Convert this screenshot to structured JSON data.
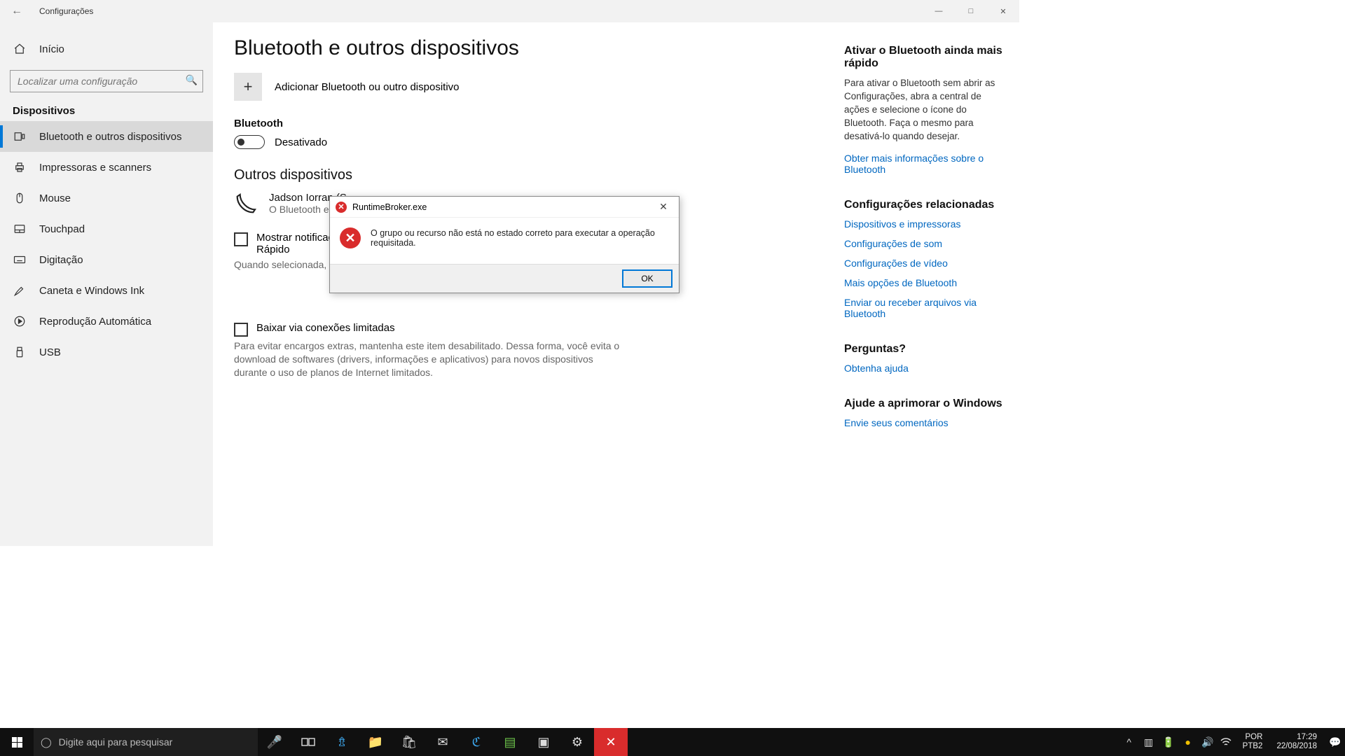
{
  "window": {
    "title": "Configurações"
  },
  "sidebar": {
    "home": "Início",
    "search_placeholder": "Localizar uma configuração",
    "category": "Dispositivos",
    "items": [
      {
        "label": "Bluetooth e outros dispositivos"
      },
      {
        "label": "Impressoras e scanners"
      },
      {
        "label": "Mouse"
      },
      {
        "label": "Touchpad"
      },
      {
        "label": "Digitação"
      },
      {
        "label": "Caneta e Windows Ink"
      },
      {
        "label": "Reprodução Automática"
      },
      {
        "label": "USB"
      }
    ]
  },
  "page": {
    "title": "Bluetooth e outros dispositivos",
    "add_label": "Adicionar Bluetooth ou outro dispositivo",
    "bt_section": "Bluetooth",
    "bt_state": "Desativado",
    "other_section": "Outros dispositivos",
    "device": {
      "name": "Jadson Iorran  (S",
      "sub": "O Bluetooth est"
    },
    "chk1_label": "Mostrar notificaçõ",
    "chk1_label2": "Rápido",
    "chk1_help": "Quando selecionada, vo     Bluetooth com suporte     próximos e no modo de emparelhamento.",
    "chk2_label": "Baixar via conexões limitadas",
    "chk2_help": "Para evitar encargos extras, mantenha este item desabilitado. Dessa forma, você evita o download de softwares (drivers, informações e aplicativos) para novos dispositivos durante o uso de planos de Internet limitados."
  },
  "right": {
    "g1_title": "Ativar o Bluetooth ainda mais rápido",
    "g1_body": "Para ativar o Bluetooth sem abrir as Configurações, abra a central de ações e selecione o ícone do Bluetooth. Faça o mesmo para desativá-lo quando desejar.",
    "g1_link": "Obter mais informações sobre o Bluetooth",
    "g2_title": "Configurações relacionadas",
    "g2_links": [
      "Dispositivos e impressoras",
      "Configurações de som",
      "Configurações de vídeo",
      "Mais opções de Bluetooth",
      "Enviar ou receber arquivos via Bluetooth"
    ],
    "g3_title": "Perguntas?",
    "g3_link": "Obtenha ajuda",
    "g4_title": "Ajude a aprimorar o Windows",
    "g4_link": "Envie seus comentários"
  },
  "dialog": {
    "title": "RuntimeBroker.exe",
    "message": "O grupo ou recurso não está no estado correto para executar a operação requisitada.",
    "ok": "OK"
  },
  "taskbar": {
    "search": "Digite aqui para pesquisar",
    "lang1": "POR",
    "lang2": "PTB2",
    "time": "17:29",
    "date": "22/08/2018"
  }
}
